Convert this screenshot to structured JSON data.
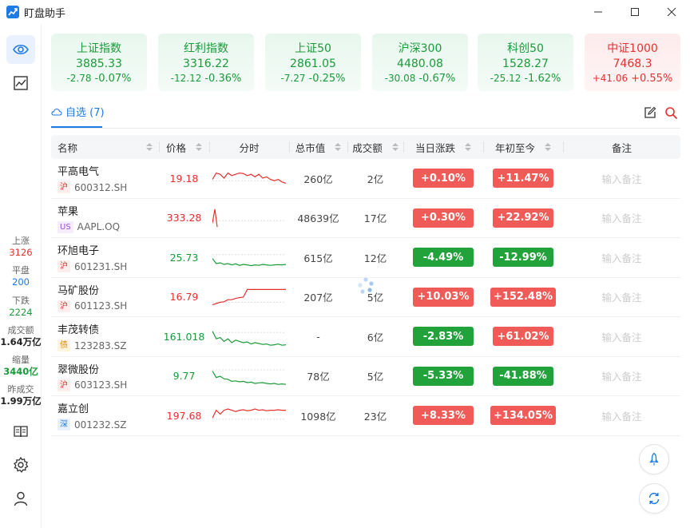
{
  "app": {
    "title": "盯盘助手"
  },
  "colors": {
    "accent": "#1e7be6",
    "up": "#e5312f",
    "down": "#1a9b3a"
  },
  "indices": [
    {
      "name": "上证指数",
      "value": "3885.33",
      "change": "-2.78",
      "pct": "-0.07%",
      "dir": "down"
    },
    {
      "name": "红利指数",
      "value": "3316.22",
      "change": "-12.12",
      "pct": "-0.36%",
      "dir": "down"
    },
    {
      "name": "上证50",
      "value": "2861.05",
      "change": "-7.27",
      "pct": "-0.25%",
      "dir": "down"
    },
    {
      "name": "沪深300",
      "value": "4480.08",
      "change": "-30.08",
      "pct": "-0.67%",
      "dir": "down"
    },
    {
      "name": "科创50",
      "value": "1528.27",
      "change": "-25.12",
      "pct": "-1.62%",
      "dir": "down"
    },
    {
      "name": "中证1000",
      "value": "7468.3",
      "change": "+41.06",
      "pct": "+0.55%",
      "dir": "up"
    }
  ],
  "sidebar": {
    "stats": [
      {
        "label": "上涨",
        "value": "3126",
        "color": "#e5312f"
      },
      {
        "label": "平盘",
        "value": "200",
        "color": "#1e7be6"
      },
      {
        "label": "下跌",
        "value": "2224",
        "color": "#1a9b3a"
      },
      {
        "label": "成交额",
        "value": "1.64万亿",
        "color": "#222"
      },
      {
        "label": "缩量",
        "value": "3440亿",
        "color": "#1a9b3a"
      },
      {
        "label": "昨成交",
        "value": "1.99万亿",
        "color": "#222"
      }
    ]
  },
  "tab": {
    "label": "自选 (7)"
  },
  "table": {
    "headers": {
      "name": "名称",
      "price": "价格",
      "spark": "分时",
      "cap": "总市值",
      "vol": "成交额",
      "day": "当日涨跌",
      "ytd": "年初至今",
      "note": "备注"
    },
    "note_placeholder": "输入备注",
    "rows": [
      {
        "name": "平高电气",
        "market": "沪",
        "mtype": "sh",
        "code": "600312.SH",
        "price": "19.18",
        "pdir": "up",
        "cap": "260亿",
        "vol": "2亿",
        "day": "+0.10%",
        "ddir": "up",
        "ytd": "+11.47%",
        "ydir": "up",
        "spark": [
          0.55,
          0.3,
          0.35,
          0.5,
          0.3,
          0.4,
          0.35,
          0.3,
          0.32,
          0.4,
          0.35,
          0.45,
          0.35,
          0.5,
          0.45,
          0.55,
          0.6,
          0.55,
          0.65,
          0.7
        ],
        "base": 0.6,
        "scolor": "#e5312f"
      },
      {
        "name": "苹果",
        "market": "US",
        "mtype": "us",
        "code": "AAPL.OQ",
        "price": "333.28",
        "pdir": "up",
        "cap": "48639亿",
        "vol": "17亿",
        "day": "+0.30%",
        "ddir": "up",
        "ytd": "+22.92%",
        "ydir": "up",
        "spark": [
          0.7,
          0.15,
          0.85
        ],
        "base": 0.6,
        "scolor": "#e5312f",
        "short": true
      },
      {
        "name": "环旭电子",
        "market": "沪",
        "mtype": "sh",
        "code": "601231.SH",
        "price": "25.73",
        "pdir": "down",
        "cap": "615亿",
        "vol": "12亿",
        "day": "-4.49%",
        "ddir": "down",
        "ytd": "-12.99%",
        "ydir": "down",
        "spark": [
          0.55,
          0.75,
          0.72,
          0.78,
          0.75,
          0.8,
          0.76,
          0.82,
          0.78,
          0.8,
          0.83,
          0.8,
          0.82,
          0.78,
          0.8,
          0.82,
          0.8,
          0.79,
          0.8,
          0.78
        ],
        "base": 0.4,
        "scolor": "#1a9b3a"
      },
      {
        "name": "马矿股份",
        "market": "沪",
        "mtype": "sh",
        "code": "601123.SH",
        "price": "16.79",
        "pdir": "up",
        "cap": "207亿",
        "vol": "5亿",
        "day": "+10.03%",
        "ddir": "up",
        "ytd": "+152.48%",
        "ydir": "up",
        "spark": [
          0.8,
          0.75,
          0.7,
          0.68,
          0.6,
          0.6,
          0.55,
          0.52,
          0.5,
          0.2,
          0.2,
          0.2,
          0.2,
          0.2,
          0.2,
          0.2,
          0.2,
          0.2,
          0.2,
          0.2
        ],
        "base": 0.7,
        "scolor": "#e5312f"
      },
      {
        "name": "丰茂转债",
        "market": "债",
        "mtype": "bond",
        "code": "123283.SZ",
        "price": "161.018",
        "pdir": "down",
        "cap": "-",
        "vol": "6亿",
        "day": "-2.83%",
        "ddir": "down",
        "ytd": "+61.02%",
        "ydir": "up",
        "spark": [
          0.3,
          0.6,
          0.55,
          0.7,
          0.6,
          0.75,
          0.65,
          0.7,
          0.75,
          0.72,
          0.8,
          0.75,
          0.78,
          0.82,
          0.8,
          0.85,
          0.83,
          0.8,
          0.85,
          0.83
        ],
        "base": 0.35,
        "scolor": "#1a9b3a"
      },
      {
        "name": "翠微股份",
        "market": "沪",
        "mtype": "sh",
        "code": "603123.SH",
        "price": "9.77",
        "pdir": "down",
        "cap": "78亿",
        "vol": "5亿",
        "day": "-5.33%",
        "ddir": "down",
        "ytd": "-41.88%",
        "ydir": "down",
        "spark": [
          0.3,
          0.55,
          0.5,
          0.6,
          0.62,
          0.7,
          0.68,
          0.72,
          0.7,
          0.75,
          0.73,
          0.78,
          0.76,
          0.75,
          0.78,
          0.8,
          0.78,
          0.82,
          0.8,
          0.82
        ],
        "base": 0.25,
        "scolor": "#1a9b3a"
      },
      {
        "name": "嘉立创",
        "market": "深",
        "mtype": "sz",
        "code": "001232.SZ",
        "price": "197.68",
        "pdir": "up",
        "cap": "1098亿",
        "vol": "23亿",
        "day": "+8.33%",
        "ddir": "up",
        "ytd": "+134.05%",
        "ydir": "up",
        "spark": [
          0.6,
          0.3,
          0.45,
          0.3,
          0.25,
          0.3,
          0.35,
          0.3,
          0.28,
          0.32,
          0.3,
          0.25,
          0.3,
          0.28,
          0.32,
          0.3,
          0.3,
          0.28,
          0.3,
          0.3
        ],
        "base": 0.65,
        "scolor": "#e5312f"
      }
    ]
  }
}
